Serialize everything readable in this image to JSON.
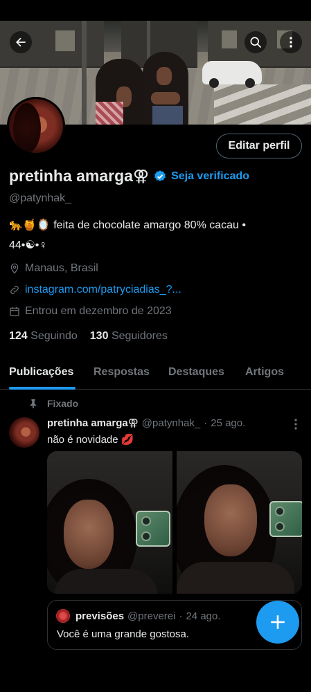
{
  "profile": {
    "display_name": "pretinha amarga⚢",
    "handle": "@patynhak_",
    "verify_label": "Seja verificado",
    "edit_button": "Editar perfil",
    "bio_line1": "🐆🍯🪞  feita de chocolate amargo 80% cacau •",
    "bio_line2": "44•☯•♀",
    "location": "Manaus, Brasil",
    "website": "instagram.com/patryciadias_?...",
    "joined": "Entrou em dezembro de 2023",
    "following_count": "124",
    "following_label": "Seguindo",
    "followers_count": "130",
    "followers_label": "Seguidores"
  },
  "tabs": [
    "Publicações",
    "Respostas",
    "Destaques",
    "Artigos"
  ],
  "active_tab": "Publicações",
  "pinned_label": "Fixado",
  "post": {
    "author_name": "pretinha amarga⚢",
    "author_handle": "@patynhak_",
    "separator": "·",
    "date": "25 ago.",
    "text": "não é novidade 💋",
    "image_count": 2
  },
  "quoted_post": {
    "author_name": "previsões",
    "author_handle": "@preverei",
    "date": "24 ago.",
    "text": "Você é uma grande gostosa."
  },
  "icons": {
    "back": "arrow-left-icon",
    "search": "search-icon",
    "more": "more-vertical-icon",
    "verified": "verified-badge-icon",
    "location": "location-pin-icon",
    "link": "link-icon",
    "calendar": "calendar-icon",
    "pin": "pin-icon",
    "compose": "plus-icon"
  },
  "colors": {
    "accent": "#1d9bf0",
    "background": "#000000",
    "text_primary": "#e7e9ea",
    "text_secondary": "#71767b",
    "border": "#2f3336"
  }
}
